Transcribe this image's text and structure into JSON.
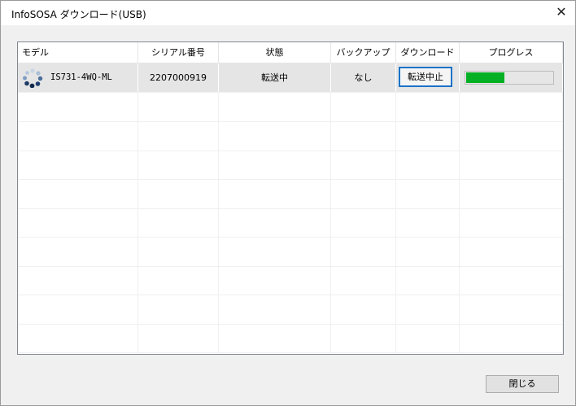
{
  "window": {
    "title": "InfoSOSA ダウンロード(USB)",
    "close_glyph": "✕"
  },
  "table": {
    "columns": [
      "モデル",
      "シリアル番号",
      "状態",
      "バックアップ",
      "ダウンロード",
      "プログレス"
    ],
    "rows": [
      {
        "model": "IS731-4WQ-ML",
        "serial": "2207000919",
        "status": "転送中",
        "backup": "なし",
        "download_button": "転送中止",
        "progress": 0.44
      }
    ],
    "empty_rows": 9
  },
  "footer": {
    "close_button": "閉じる"
  },
  "colors": {
    "progress_fill": "#06b025",
    "focus_border": "#1a73c8"
  },
  "icons": {
    "model_icon": "loading-spinner-icon",
    "close": "close-icon"
  }
}
